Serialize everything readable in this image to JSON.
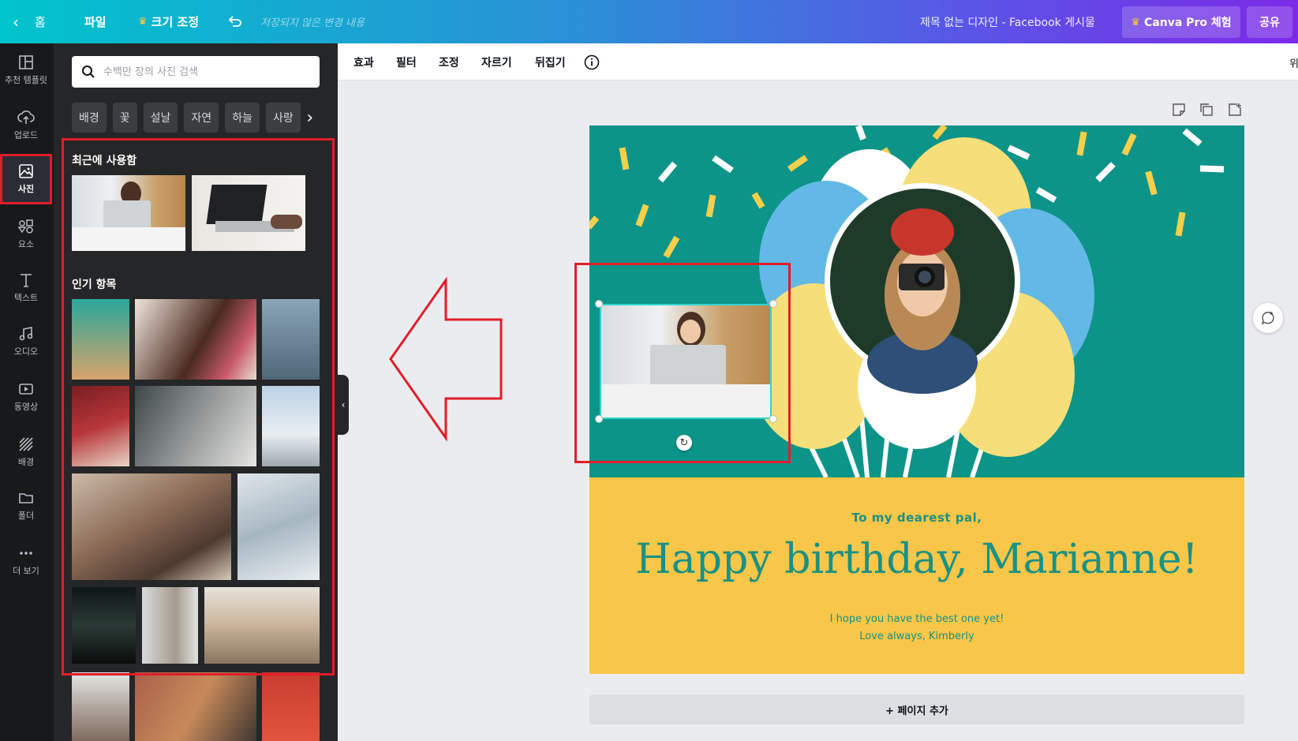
{
  "topbar": {
    "home_label": "홈",
    "file_label": "파일",
    "resize_label": "크기 조정",
    "unsaved_label": "저장되지 않은 변경 내용",
    "doc_title": "제목 없는 디자인 - Facebook 게시물",
    "pro_label": "Canva Pro 체험",
    "share_label": "공유"
  },
  "rail": {
    "items": [
      {
        "label": "추천 템플릿",
        "icon": "template-icon"
      },
      {
        "label": "업로드",
        "icon": "upload-icon"
      },
      {
        "label": "사진",
        "icon": "photo-icon"
      },
      {
        "label": "요소",
        "icon": "elements-icon"
      },
      {
        "label": "텍스트",
        "icon": "text-icon"
      },
      {
        "label": "오디오",
        "icon": "audio-icon"
      },
      {
        "label": "동영상",
        "icon": "video-icon"
      },
      {
        "label": "배경",
        "icon": "background-icon"
      },
      {
        "label": "폴더",
        "icon": "folder-icon"
      },
      {
        "label": "더 보기",
        "icon": "more-icon"
      }
    ]
  },
  "panel": {
    "search_placeholder": "수백만 장의 사진 검색",
    "chips": [
      "배경",
      "꽃",
      "설날",
      "자연",
      "하늘",
      "사랑"
    ],
    "recent_title": "최근에 사용함",
    "popular_title": "인기 항목"
  },
  "toolbar": {
    "items": [
      "효과",
      "필터",
      "조정",
      "자르기",
      "뒤집기"
    ],
    "edge_text": "위"
  },
  "design": {
    "line1": "To my dearest pal,",
    "line2": "Happy birthday, Marianne!",
    "line3": "I hope you have the best one yet!",
    "line4": "Love always, Kimberly",
    "colors": {
      "teal": "#0c9488",
      "yellow": "#f8c648",
      "text": "#1a9184"
    }
  },
  "add_page_label": "+ 페이지 추가",
  "annotation_color": "#e01e2a"
}
